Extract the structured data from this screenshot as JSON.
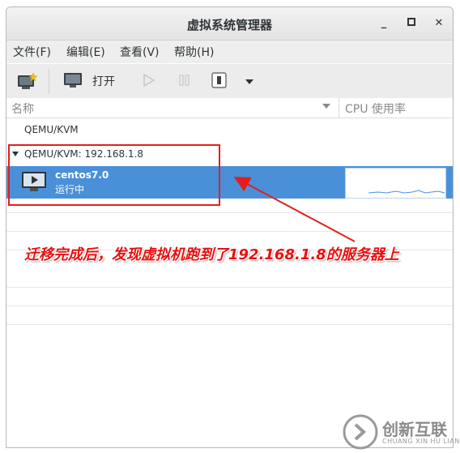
{
  "window": {
    "title": "虚拟系统管理器",
    "controls": [
      "minimize",
      "maximize",
      "close"
    ],
    "minimize_glyph": "_",
    "maximize_glyph": "▫",
    "close_glyph": "✕"
  },
  "menubar": {
    "items": [
      "文件(F)",
      "编辑(E)",
      "查看(V)",
      "帮助(H)"
    ]
  },
  "toolbar": {
    "open_label": "打开",
    "icons": [
      "new-vm-icon",
      "monitor-icon",
      "play-icon",
      "pause-icon",
      "power-icon",
      "dropdown-arrow-icon"
    ]
  },
  "columns": {
    "name": "名称",
    "cpu": "CPU 使用率"
  },
  "connections": [
    {
      "label": "QEMU/KVM",
      "expanded": false
    },
    {
      "label": "QEMU/KVM: 192.168.1.8",
      "expanded": true
    }
  ],
  "vm": {
    "name": "centos7.0",
    "status": "运行中"
  },
  "annotation": {
    "text": "迁移完成后，发现虚拟机跑到了192.168.1.8的服务器上"
  },
  "watermark": {
    "text": "创新互联",
    "sub": "CHUANG XIN HU LIAN"
  },
  "colors": {
    "selection": "#4a90d9",
    "annotation": "#e81010"
  }
}
